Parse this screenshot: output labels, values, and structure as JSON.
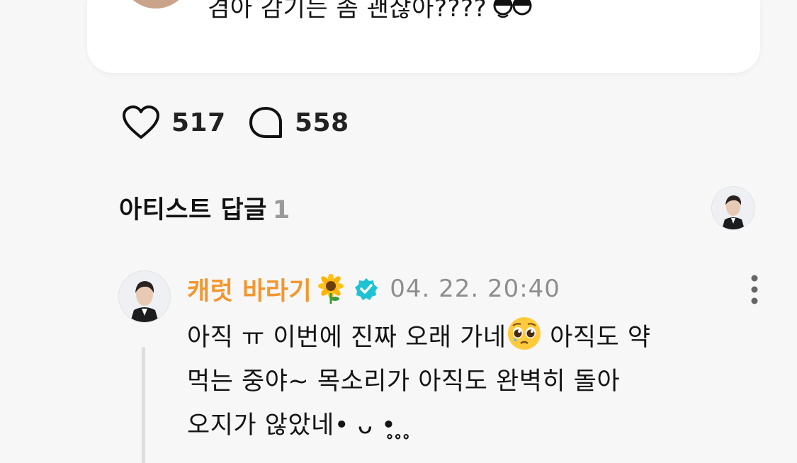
{
  "post": {
    "text": "겸아 감기는 좀 괜찮아????",
    "emoji_icon": "peeking-eyes-emoji"
  },
  "reactions": {
    "like_count": "517",
    "comment_count": "558",
    "like_icon": "heart-outline-icon",
    "comment_icon": "speech-bubble-icon"
  },
  "artist_replies": {
    "title": "아티스트 답글",
    "count": "1"
  },
  "reply": {
    "author": "캐럿 바라기",
    "author_emoji": "sunflower-emoji",
    "verified_icon": "verified-badge-icon",
    "timestamp": "04. 22. 20:40",
    "lines": {
      "l1a": "아직 ㅠ 이번에 진짜 오래 가네",
      "l1b": " 아직도 약",
      "l2": "먹는 중야~ 목소리가 아직도 완벽히 돌아",
      "l3": "오지가 않았네• ᴗ •̥ ̥ ̥"
    },
    "inline_emoji": "pleading-face-emoji"
  },
  "colors": {
    "background": "#f7f7f8",
    "card": "#ffffff",
    "author": "#f3962e",
    "verified": "#1fc2d5",
    "muted_text": "#8e8e8e",
    "count_gray": "#9a9a9a"
  }
}
